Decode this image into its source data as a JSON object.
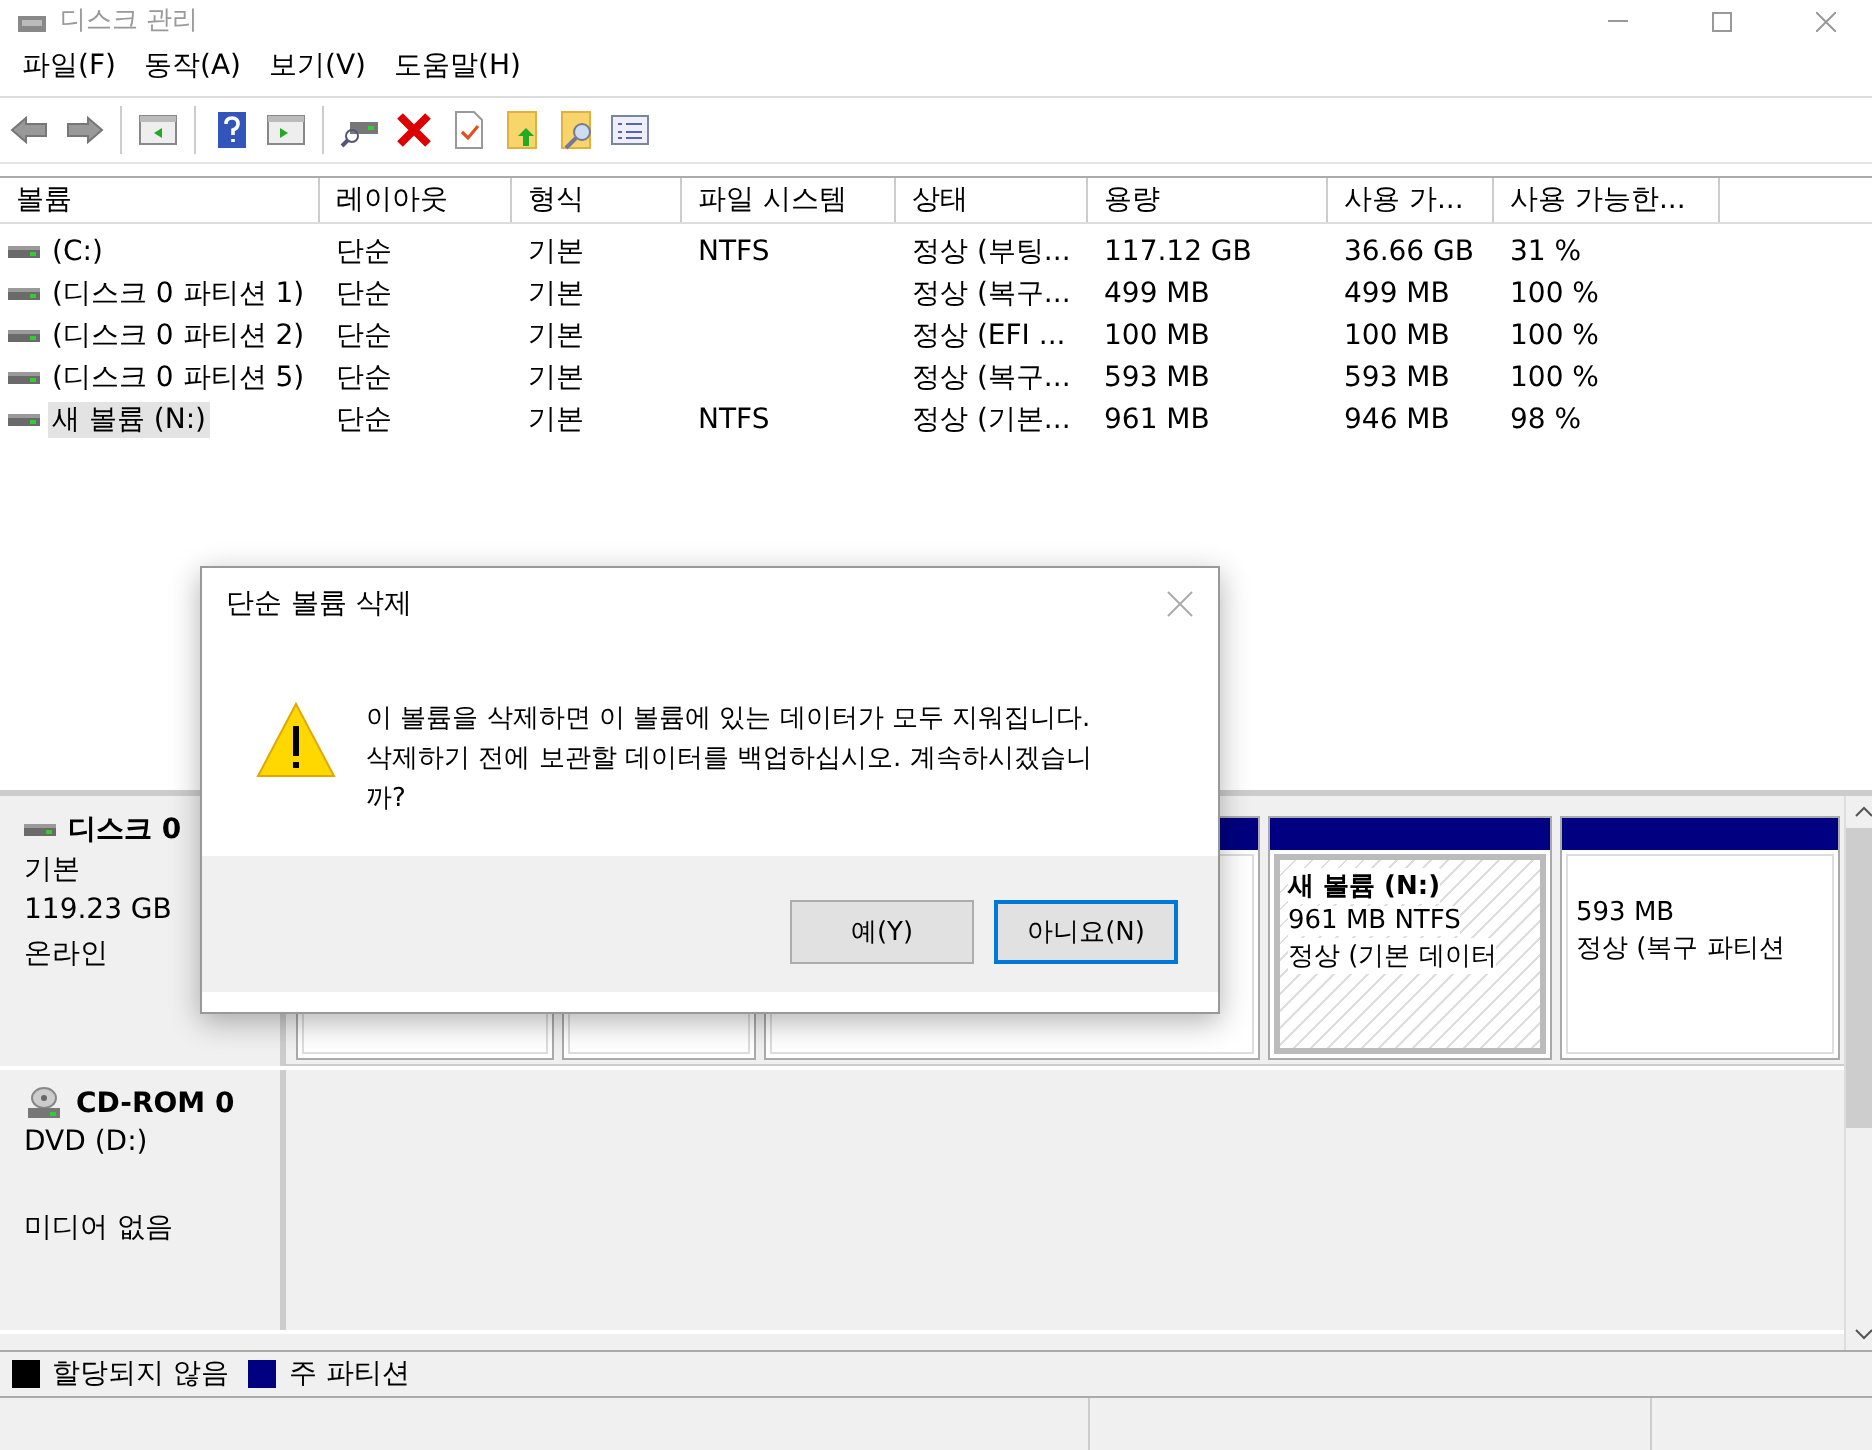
{
  "window": {
    "title": "디스크 관리"
  },
  "menu": [
    "파일(F)",
    "동작(A)",
    "보기(V)",
    "도움말(H)"
  ],
  "table": {
    "columns": [
      "볼륨",
      "레이아웃",
      "형식",
      "파일 시스템",
      "상태",
      "용량",
      "사용 가...",
      "사용 가능한..."
    ],
    "rows": [
      {
        "cells": [
          "(C:)",
          "단순",
          "기본",
          "NTFS",
          "정상 (부팅...",
          "117.12 GB",
          "36.66 GB",
          "31 %"
        ],
        "selected": false
      },
      {
        "cells": [
          "(디스크 0 파티션 1)",
          "단순",
          "기본",
          "",
          "정상 (복구...",
          "499 MB",
          "499 MB",
          "100 %"
        ],
        "selected": false
      },
      {
        "cells": [
          "(디스크 0 파티션 2)",
          "단순",
          "기본",
          "",
          "정상 (EFI ...",
          "100 MB",
          "100 MB",
          "100 %"
        ],
        "selected": false
      },
      {
        "cells": [
          "(디스크 0 파티션 5)",
          "단순",
          "기본",
          "",
          "정상 (복구...",
          "593 MB",
          "593 MB",
          "100 %"
        ],
        "selected": false
      },
      {
        "cells": [
          "새 볼륨 (N:)",
          "단순",
          "기본",
          "NTFS",
          "정상 (기본...",
          "961 MB",
          "946 MB",
          "98 %"
        ],
        "selected": true
      }
    ]
  },
  "disks": [
    {
      "kind": "disk",
      "name": "디스크 0",
      "lines": [
        "기본",
        "119.23 GB",
        "온라인"
      ],
      "partitions": [
        {
          "selected": false
        },
        {
          "selected": false
        },
        {
          "selected": false
        },
        {
          "selected": true,
          "name": "새 볼륨  (N:)",
          "lines": [
            "961 MB NTFS",
            "정상 (기본 데이터"
          ]
        },
        {
          "selected": false,
          "lines": [
            "593 MB",
            "정상 (복구 파티션"
          ]
        }
      ]
    },
    {
      "kind": "cdrom",
      "name": "CD-ROM 0",
      "lines": [
        "DVD (D:)",
        "미디어 없음"
      ]
    }
  ],
  "legend": [
    {
      "label": "할당되지 않음",
      "color": "#000000"
    },
    {
      "label": "주 파티션",
      "color": "#000080"
    }
  ],
  "dialog": {
    "title": "단순 볼륨 삭제",
    "message": "이 볼륨을 삭제하면 이 볼륨에 있는 데이터가 모두 지워집니다. 삭제하기 전에 보관할 데이터를 백업하십시오. 계속하시겠습니까?",
    "buttons": [
      {
        "label": "예(Y)",
        "focused": false
      },
      {
        "label": "아니요(N)",
        "focused": true
      }
    ]
  }
}
